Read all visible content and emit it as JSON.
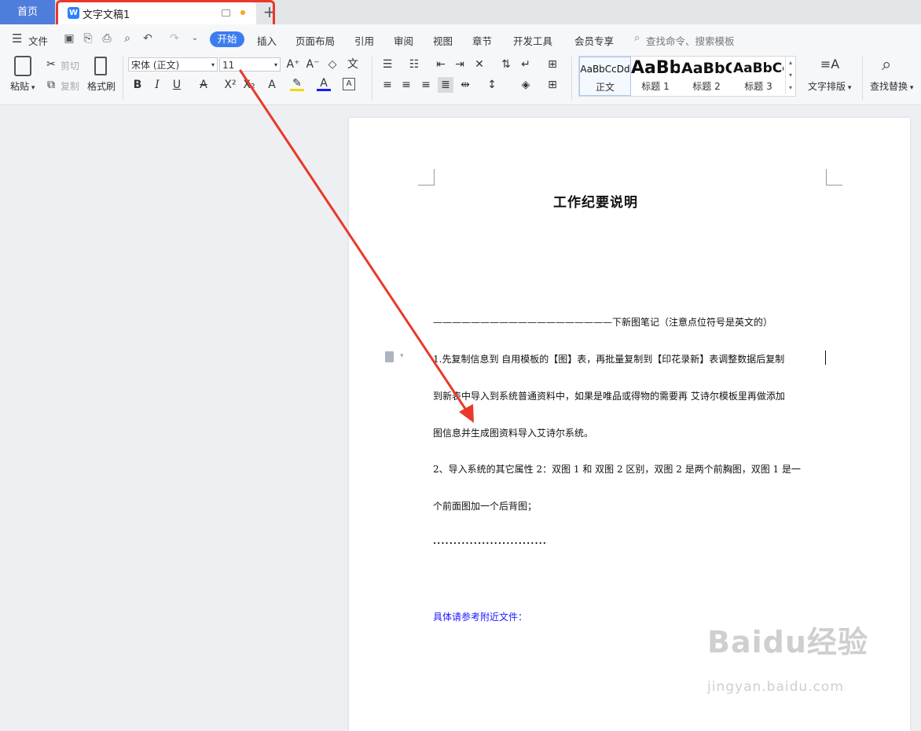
{
  "tabs": {
    "home": "首页",
    "document": "文字文稿1",
    "new_tab": "+"
  },
  "menu": {
    "file": "文件",
    "items": [
      "开始",
      "插入",
      "页面布局",
      "引用",
      "审阅",
      "视图",
      "章节",
      "开发工具",
      "会员专享"
    ],
    "search": "查找命令、搜索模板"
  },
  "ribbon": {
    "paste": "粘贴",
    "cut": "剪切",
    "copy": "复制",
    "format_painter": "格式刷",
    "font_name": "宋体 (正文)",
    "font_size": "11",
    "styles": [
      {
        "preview": "AaBbCcDd",
        "label": "正文"
      },
      {
        "preview": "AaBb",
        "label": "标题 1"
      },
      {
        "preview": "AaBbC",
        "label": "标题 2"
      },
      {
        "preview": "AaBbCc",
        "label": "标题 3"
      }
    ],
    "text_layout": "文字排版",
    "find_replace": "查找替换"
  },
  "document": {
    "title": "工作纪要说明",
    "lines": [
      "———————————————————下新图笔记（注意点位符号是英文的）",
      "1.先复制信息到 自用模板的【图】表，再批量复制到【印花录新】表调整数据后复制",
      "到新表中导入到系统普通资料中，如果是唯品或得物的需要再 艾诗尔模板里再做添加",
      "图信息并生成图资料导入艾诗尔系统。",
      "2、导入系统的其它属性 2：双图 1  和  双图 2  区别，双图 2 是两个前胸图，双图 1 是一",
      "个前面图加一个后背图；",
      "............................"
    ],
    "link_line": "具体请参考附近文件："
  },
  "watermark": {
    "text": "Baidu经验",
    "sub": "jingyan.baidu.com"
  },
  "colors": {
    "accent": "#3d7cf0",
    "annotation": "#e8392b",
    "link_text": "#1a1aff"
  }
}
